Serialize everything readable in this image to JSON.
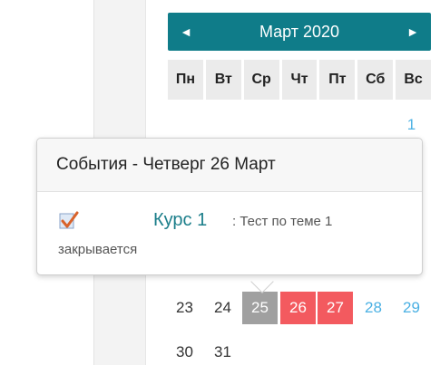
{
  "calendar": {
    "month_title": "Март 2020",
    "prev_icon": "◄",
    "next_icon": "►",
    "weekdays": [
      "Пн",
      "Вт",
      "Ср",
      "Чт",
      "Пт",
      "Сб",
      "Вс"
    ],
    "days": {
      "d1": "1",
      "d23": "23",
      "d24": "24",
      "d25": "25",
      "d26": "26",
      "d27": "27",
      "d28": "28",
      "d29": "29",
      "d30": "30",
      "d31": "31"
    },
    "colors": {
      "header": "#0f7c89",
      "event_day": "#f35a5f",
      "past_day": "#a0a0a0",
      "weekend": "#4ab0e3"
    }
  },
  "popup": {
    "title": "События - Четверг 26 Март",
    "course_link": "Курс 1",
    "event_text": ": Тест по теме 1",
    "event_text_2": "закрывается",
    "icon": "quiz-checkbox-icon"
  }
}
